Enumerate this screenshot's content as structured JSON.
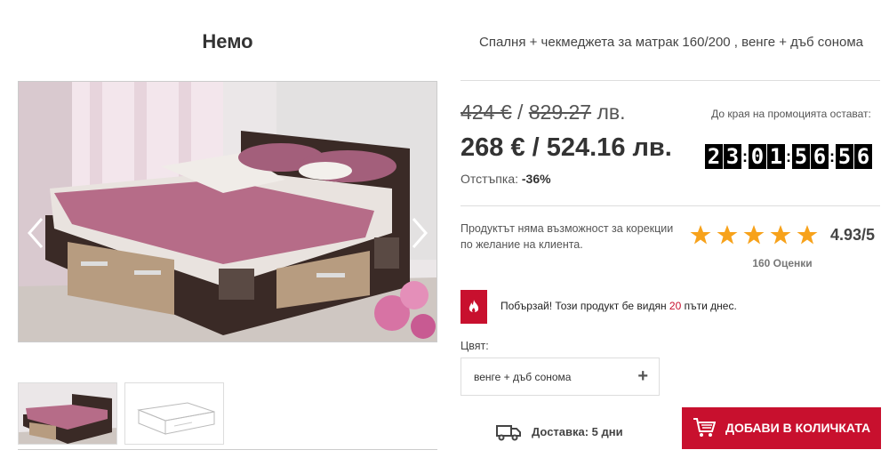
{
  "product": {
    "name": "Немо",
    "subtitle": "Спалня + чекмеджета за матрак 160/200 , венге + дъб сонома"
  },
  "pricing": {
    "old_eur": "424 €",
    "separator": " / ",
    "old_bgn": "829.27",
    "old_bgn_unit": " лв.",
    "new_price": "268 € / 524.16 лв.",
    "discount_label": "Отстъпка: ",
    "discount_value": "-36%"
  },
  "promo": {
    "label": "До края на промоцията остават:",
    "countdown": [
      "2",
      "3",
      "0",
      "1",
      "5",
      "6",
      "5",
      "6"
    ]
  },
  "notice": "Продуктът няма възможност за корекции по желание на клиента.",
  "rating": {
    "value": "4.93/5",
    "stars": 5,
    "reviews": "160 Оценки"
  },
  "hurry": {
    "prefix": "Побързай! Този продукт бе видян ",
    "count": "20",
    "suffix": " пъти днес."
  },
  "color": {
    "label": "Цвят:",
    "selected": "венге + дъб сонома",
    "plus": "+"
  },
  "delivery": "Доставка: 5 дни",
  "cart_button": "ДОБАВИ В КОЛИЧКАТА",
  "colors": {
    "accent": "#c8102e",
    "star": "#f7a21b"
  },
  "icons": {
    "arrows": [
      "chevron-left-icon",
      "chevron-right-icon"
    ],
    "fire": "fire-icon",
    "truck": "truck-icon",
    "cart": "cart-icon",
    "star": "star-icon"
  }
}
